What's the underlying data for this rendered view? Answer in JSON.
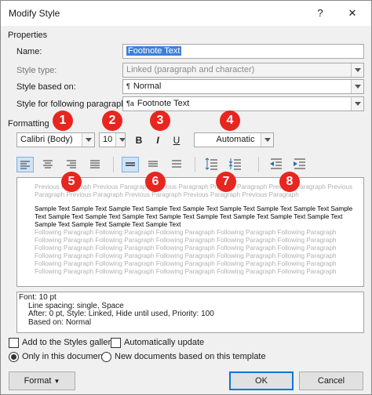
{
  "window": {
    "title": "Modify Style",
    "help": "?",
    "close": "✕"
  },
  "properties": {
    "section_label": "Properties",
    "name_label": "Name:",
    "name_value": "Footnote Text",
    "style_type_label": "Style type:",
    "style_type_value": "Linked (paragraph and character)",
    "based_on_label": "Style based on:",
    "based_on_value": "Normal",
    "based_on_icon": "¶",
    "following_label": "Style for following paragraph:",
    "following_value": "Footnote Text",
    "following_icon": "¶a"
  },
  "formatting": {
    "section_label": "Formatting",
    "font": "Calibri (Body)",
    "size": "10",
    "bold": "B",
    "italic": "I",
    "underline": "U",
    "color": "Automatic"
  },
  "badges": [
    "1",
    "2",
    "3",
    "4",
    "5",
    "6",
    "7",
    "8"
  ],
  "preview": {
    "previous_lines": [
      "Previous Paragraph Previous Paragraph Previous Paragraph Previous Paragraph Previous Paragraph Previous",
      "Paragraph Previous Paragraph Previous Paragraph Previous Paragraph Previous Paragraph"
    ],
    "sample_lines": [
      "Sample Text Sample Text Sample Text Sample Text Sample Text Sample Text Sample Text Sample Text Sample",
      "Text Sample Text Sample Text Sample Text Sample Text Sample Text Sample Text Sample Text Sample Text",
      "Sample Text Sample Text Sample Text Sample Text"
    ],
    "following_lines": [
      "Following Paragraph Following Paragraph Following Paragraph Following Paragraph Following Paragraph",
      "Following Paragraph Following Paragraph Following Paragraph Following Paragraph Following Paragraph",
      "Following Paragraph Following Paragraph Following Paragraph Following Paragraph Following Paragraph",
      "Following Paragraph Following Paragraph Following Paragraph Following Paragraph Following Paragraph",
      "Following Paragraph Following Paragraph Following Paragraph Following Paragraph Following Paragraph",
      "Following Paragraph Following Paragraph Following Paragraph Following Paragraph Following Paragraph"
    ]
  },
  "description": {
    "line1": "Font: 10 pt",
    "line2": "Line spacing:  single, Space",
    "line3": "After:  0 pt, Style: Linked, Hide until used, Priority: 100",
    "line4": "Based on: Normal"
  },
  "options": {
    "add_to_gallery": "Add to the Styles gallery",
    "auto_update": "Automatically update",
    "only_doc": "Only in this document",
    "new_docs": "New documents based on this template"
  },
  "buttons": {
    "format": "Format",
    "ok": "OK",
    "cancel": "Cancel"
  },
  "colors": {
    "badge": "#e8251f",
    "selection": "#3d7fd8",
    "accent": "#0078d7"
  }
}
